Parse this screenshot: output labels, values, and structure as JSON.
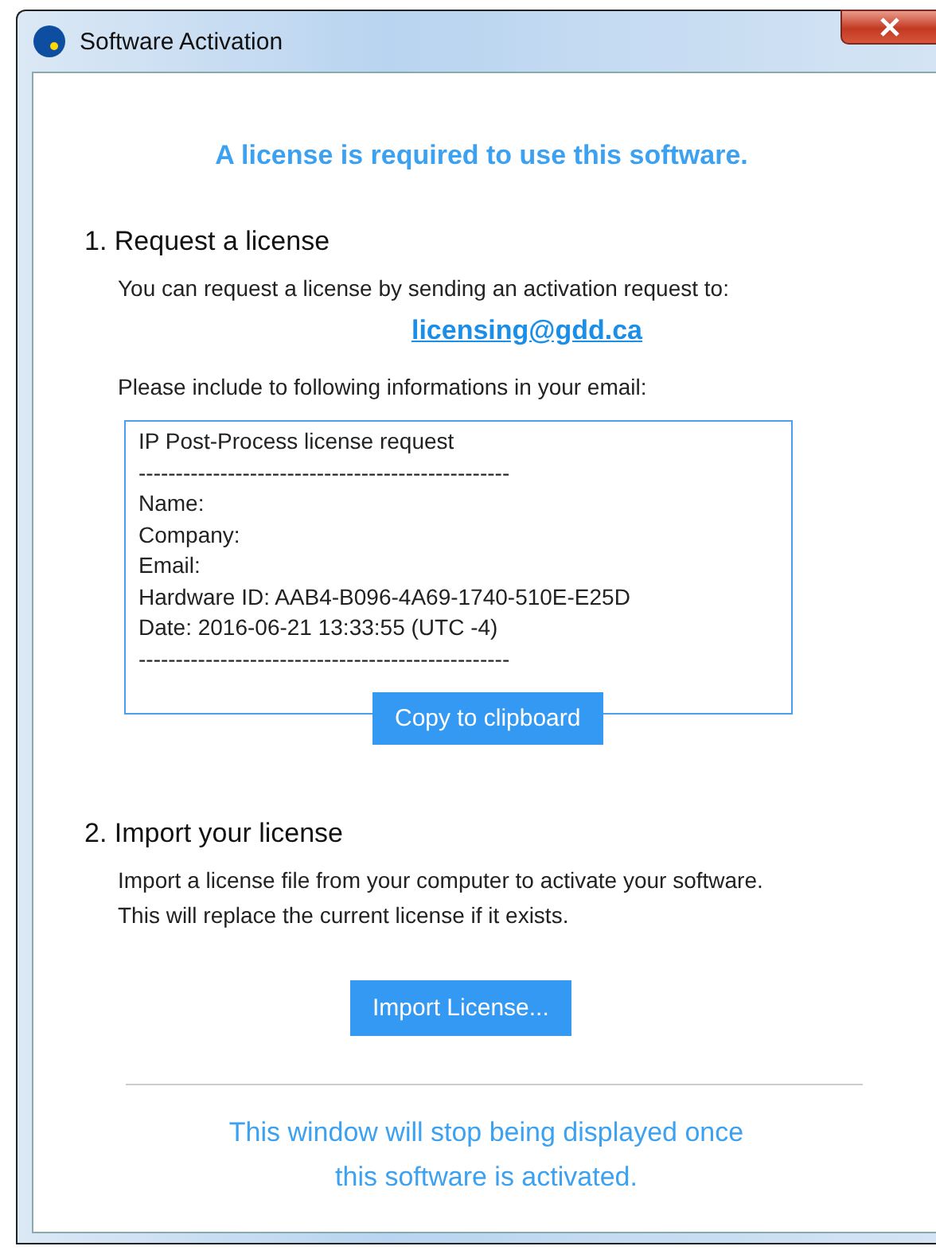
{
  "window": {
    "title": "Software Activation"
  },
  "headline": "A license is required to use this software.",
  "sections": [
    {
      "kind": "request",
      "heading": "1. Request a license",
      "intro": "You can request a license by sending an activation request to:",
      "email": "licensing@gdd.ca",
      "note": "Please include to following informations in your email:",
      "request_text": "IP Post-Process license request\n--------------------------------------------------\nName:\nCompany:\nEmail:\nHardware ID: AAB4-B096-4A69-1740-510E-E25D\nDate: 2016-06-21 13:33:55 (UTC -4)\n--------------------------------------------------",
      "button": "Copy to clipboard"
    },
    {
      "kind": "import",
      "heading": "2. Import your license",
      "intro": "Import a license file from your computer to activate your software. This will replace the current license if it exists.",
      "button": "Import License..."
    }
  ],
  "footer": "This window will stop being displayed once this software is activated."
}
